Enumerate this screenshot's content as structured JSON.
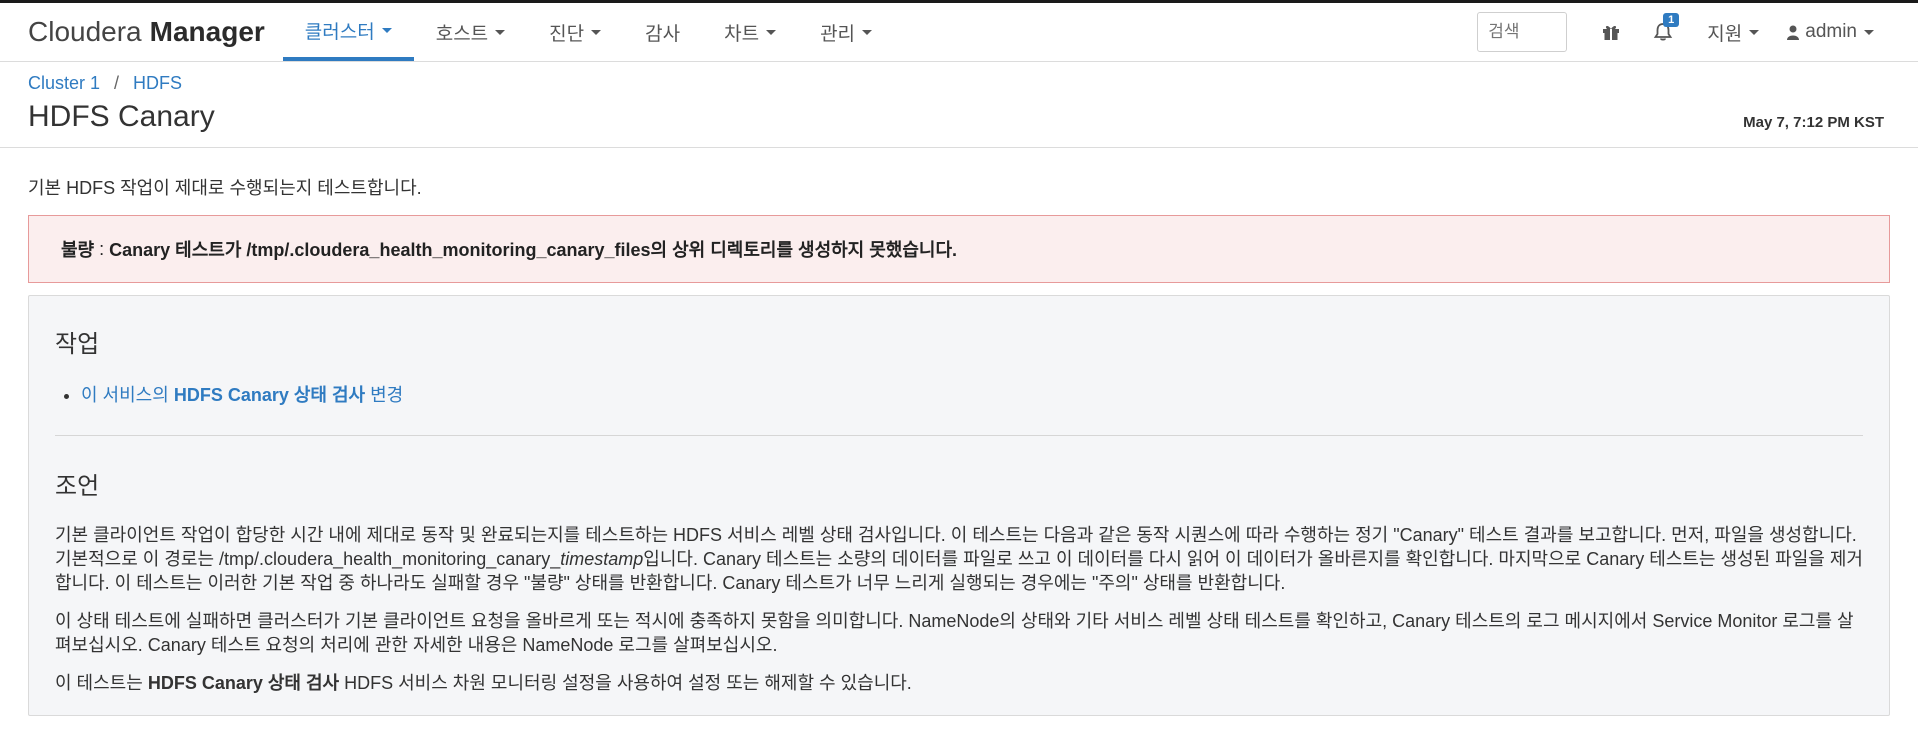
{
  "header": {
    "brand_light": "Cloudera",
    "brand_bold": "Manager",
    "nav": [
      {
        "label": "클러스터",
        "active": true,
        "dropdown": true
      },
      {
        "label": "호스트",
        "active": false,
        "dropdown": true
      },
      {
        "label": "진단",
        "active": false,
        "dropdown": true
      },
      {
        "label": "감사",
        "active": false,
        "dropdown": false
      },
      {
        "label": "차트",
        "active": false,
        "dropdown": true
      },
      {
        "label": "관리",
        "active": false,
        "dropdown": true
      }
    ],
    "search_placeholder": "검색",
    "notification_count": "1",
    "support_label": "지원",
    "user_label": "admin"
  },
  "breadcrumb": {
    "items": [
      "Cluster 1",
      "HDFS"
    ],
    "separator": "/"
  },
  "page": {
    "title": "HDFS Canary",
    "timestamp": "May 7, 7:12 PM KST",
    "description": "기본 HDFS 작업이 제대로 수행되는지 테스트합니다."
  },
  "alert": {
    "level": "불량",
    "separator": ":",
    "message": "Canary 테스트가 /tmp/.cloudera_health_monitoring_canary_files의 상위 디렉토리를 생성하지 못했습니다."
  },
  "actions": {
    "heading": "작업",
    "item_prefix": "이 서비스의",
    "item_bold": "HDFS Canary 상태 검사",
    "item_suffix": "변경"
  },
  "advice": {
    "heading": "조언",
    "p1_a": "기본 클라이언트 작업이 합당한 시간 내에 제대로 동작 및 완료되는지를 테스트하는 HDFS 서비스 레벨 상태 검사입니다. 이 테스트는 다음과 같은 동작 시퀀스에 따라 수행하는 정기 \"Canary\" 테스트 결과를 보고합니다. 먼저, 파일을 생성합니다. 기본적으로 이 경로는 /tmp/.cloudera_health_monitoring_canary_",
    "p1_italic": "timestamp",
    "p1_b": "입니다. Canary 테스트는 소량의 데이터를 파일로 쓰고 이 데이터를 다시 읽어 이 데이터가 올바른지를 확인합니다. 마지막으로 Canary 테스트는 생성된 파일을 제거합니다. 이 테스트는 이러한 기본 작업 중 하나라도 실패할 경우 \"불량\" 상태를 반환합니다. Canary 테스트가 너무 느리게 실행되는 경우에는 \"주의\" 상태를 반환합니다.",
    "p2": "이 상태 테스트에 실패하면 클러스터가 기본 클라이언트 요청을 올바르게 또는 적시에 충족하지 못함을 의미합니다. NameNode의 상태와 기타 서비스 레벨 상태 테스트를 확인하고, Canary 테스트의 로그 메시지에서 Service Monitor 로그를 살펴보십시오. Canary 테스트 요청의 처리에 관한 자세한 내용은 NameNode 로그를 살펴보십시오.",
    "p3_prefix": "이 테스트는",
    "p3_bold": "HDFS Canary 상태 검사",
    "p3_suffix": "HDFS 서비스 차원 모니터링 설정을 사용하여 설정 또는 해제할 수 있습니다."
  },
  "colors": {
    "accent": "#2f7bc1",
    "alert_bg": "#fbeeee",
    "alert_border": "#e79a9a",
    "panel_bg": "#f5f6f8"
  },
  "icons": [
    "gift-icon",
    "bell-icon",
    "user-icon",
    "chevron-down-icon"
  ]
}
